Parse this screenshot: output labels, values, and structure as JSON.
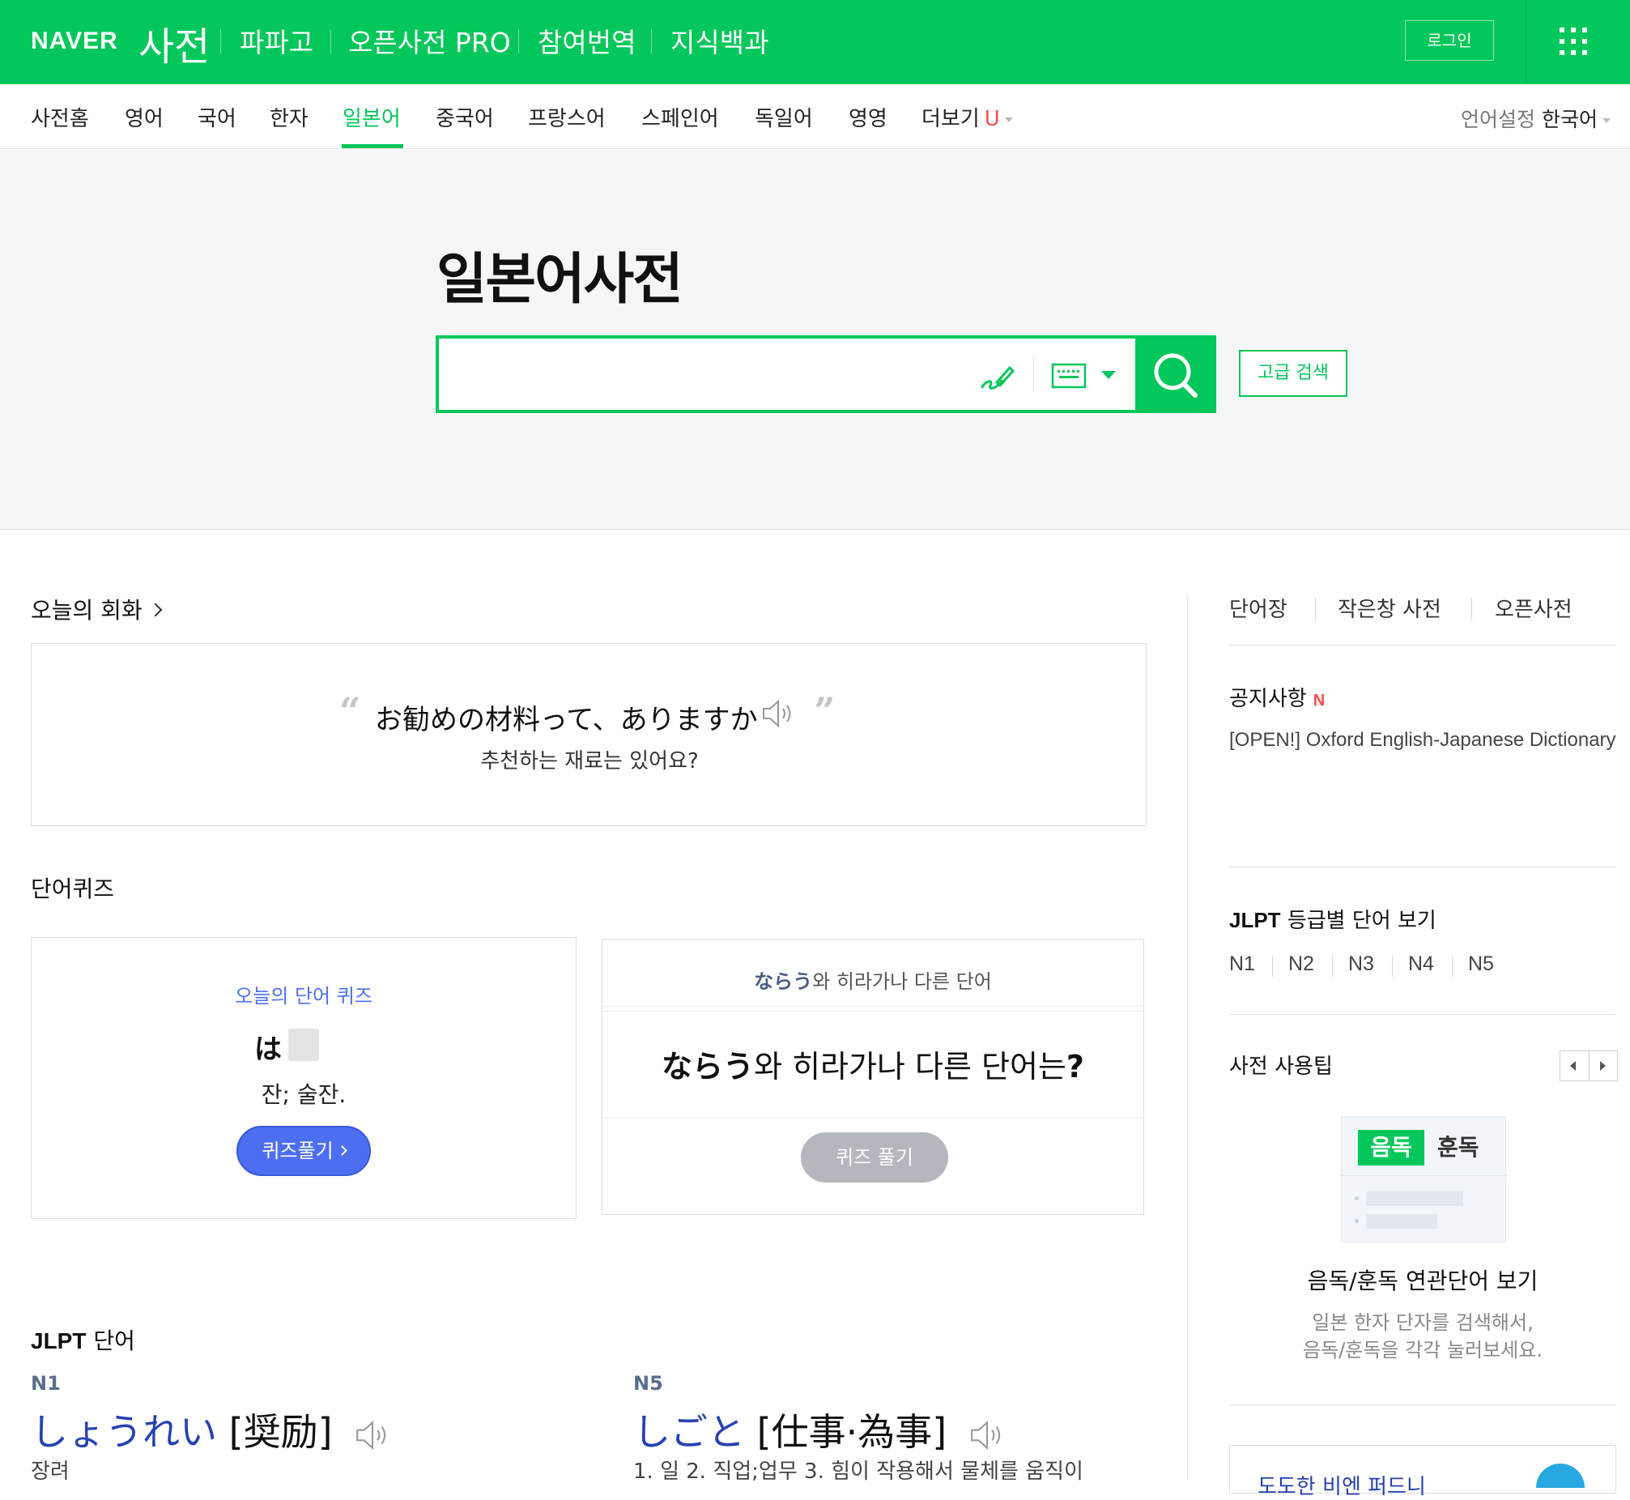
{
  "header": {
    "logo_naver": "NAVER",
    "logo_dict": "사전",
    "services": [
      "파파고",
      "오픈사전 PRO",
      "참여번역",
      "지식백과"
    ],
    "login_label": "로그인",
    "accent_color": "#03c75a"
  },
  "nav": {
    "items": [
      "사전홈",
      "영어",
      "국어",
      "한자",
      "일본어",
      "중국어",
      "프랑스어",
      "스페인어",
      "독일어",
      "영영"
    ],
    "active": "일본어",
    "more_label": "더보기",
    "more_badge": "U",
    "lang_label": "언어설정",
    "lang_value": "한국어"
  },
  "search": {
    "title": "일본어사전",
    "placeholder": "",
    "value": "",
    "advanced_label": "고급 검색",
    "icons": [
      "handwriting-icon",
      "keyboard-icon",
      "search-icon"
    ]
  },
  "conversation": {
    "title": "오늘의 회화",
    "japanese": "お勧めの材料って、ありますか",
    "korean": "추천하는 재료는 있어요?"
  },
  "word_quiz": {
    "title": "단어퀴즈",
    "card1": {
      "label": "오늘의 단어 퀴즈",
      "word": "は",
      "meaning": "잔; 술잔.",
      "button": "퀴즈풀기"
    },
    "card2": {
      "head_word": "ならう",
      "head_suffix": "와 히라가나 다른 단어",
      "question_word": "ならう",
      "question_suffix": "와 히라가나 다른 단어는",
      "question_mark": "?",
      "button": "퀴즈 풀기"
    }
  },
  "jlpt": {
    "title_bold": "JLPT",
    "title_rest": "단어",
    "items": [
      {
        "level": "N1",
        "kana": "しょうれい",
        "kanji": "[奨励]",
        "meaning": "장려"
      },
      {
        "level": "N5",
        "kana": "しごと",
        "kanji": "[仕事·為事]",
        "meaning": "1. 일 2. 직업;업무 3. 힘이 작용해서 물체를 움직이"
      }
    ]
  },
  "sidebar": {
    "tabs": [
      "단어장",
      "작은창 사전",
      "오픈사전"
    ],
    "notice_title": "공지사항",
    "notice_badge": "N",
    "notice_text": "[OPEN!] Oxford English-Japanese Dictionary",
    "jlpt_title_bold": "JLPT",
    "jlpt_title_rest": "등급별 단어 보기",
    "jlpt_levels": [
      "N1",
      "N2",
      "N3",
      "N4",
      "N5"
    ],
    "tip_title": "사전 사용팁",
    "tip_on": "음독",
    "tip_kun": "훈독",
    "tip_card_title": "음독/훈독 연관단어 보기",
    "tip_desc_1": "일본 한자 단자를 검색해서,",
    "tip_desc_2": "음독/훈독을 각각 눌러보세요.",
    "bottom_card_text": "도도한 비엔 퍼드니"
  }
}
